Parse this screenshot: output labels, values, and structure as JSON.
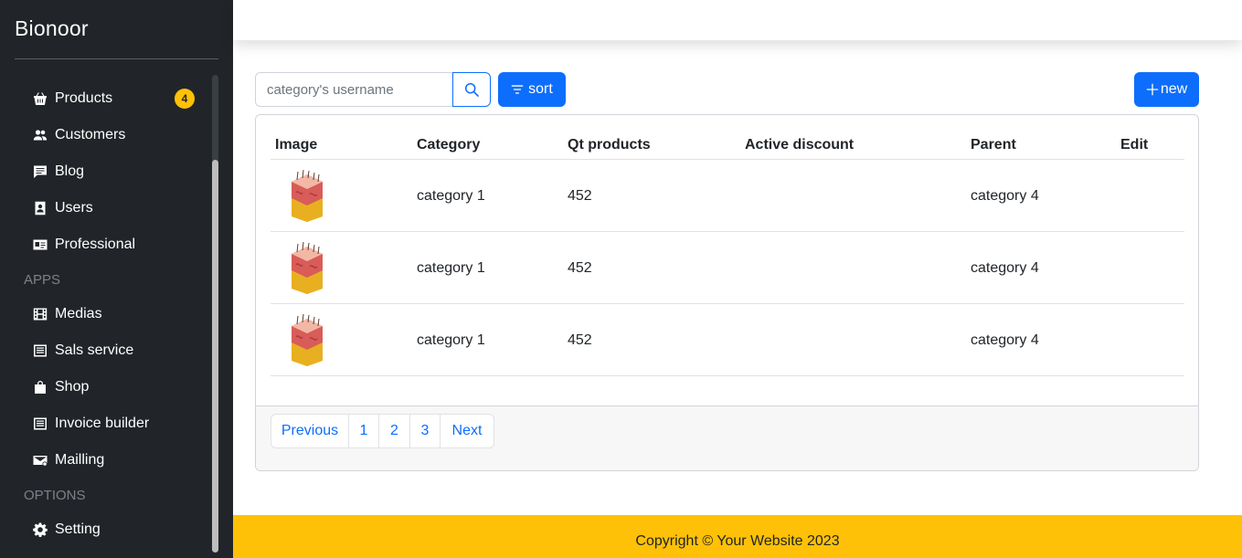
{
  "app": {
    "brand": "Bionoor"
  },
  "sidebar": {
    "items": [
      {
        "label": "Products",
        "icon": "basket-icon",
        "badge": "4"
      },
      {
        "label": "Customers",
        "icon": "people-icon"
      },
      {
        "label": "Blog",
        "icon": "chat-icon"
      },
      {
        "label": "Users",
        "icon": "person-badge-icon"
      },
      {
        "label": "Professional",
        "icon": "id-card-icon"
      }
    ],
    "apps_heading": "APPS",
    "apps": [
      {
        "label": "Medias",
        "icon": "film-icon"
      },
      {
        "label": "Sals service",
        "icon": "list-icon"
      },
      {
        "label": "Shop",
        "icon": "bag-icon"
      },
      {
        "label": "Invoice builder",
        "icon": "list-icon"
      },
      {
        "label": "Mailling",
        "icon": "envelope-icon"
      }
    ],
    "options_heading": "OPTIONS",
    "options": [
      {
        "label": "Setting",
        "icon": "gear-icon"
      }
    ]
  },
  "toolbar": {
    "search_placeholder": "category's username",
    "sort_label": "sort",
    "new_label": "new"
  },
  "table": {
    "headers": [
      "Image",
      "Category",
      "Qt products",
      "Active discount",
      "Parent",
      "Edit"
    ],
    "rows": [
      {
        "category": "category 1",
        "qt": "452",
        "discount": "",
        "parent": "category 4",
        "edit": ""
      },
      {
        "category": "category 1",
        "qt": "452",
        "discount": "",
        "parent": "category 4",
        "edit": ""
      },
      {
        "category": "category 1",
        "qt": "452",
        "discount": "",
        "parent": "category 4",
        "edit": ""
      }
    ]
  },
  "pagination": {
    "previous": "Previous",
    "pages": [
      "1",
      "2",
      "3"
    ],
    "next": "Next"
  },
  "footer": {
    "copyright": "Copyright © Your Website 2023"
  },
  "colors": {
    "sidebar_bg": "#212529",
    "primary": "#0d6efd",
    "badge": "#ffc107",
    "footer_bg": "#ffc107"
  }
}
